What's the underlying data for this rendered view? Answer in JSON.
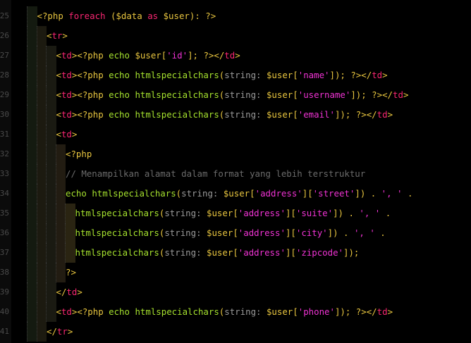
{
  "editor": {
    "theme": {
      "background": "#000000",
      "tag": "#f92672",
      "keyword": "#f92672",
      "function": "#a6e22e",
      "variable": "#e8c53f",
      "string": "#f033d4",
      "comment": "#6b6b6b",
      "param_hint": "#9a9a9a",
      "line_number": "#4a4a4a"
    },
    "lines": [
      {
        "num": "25",
        "depth": 3,
        "tokens": [
          [
            "t-php",
            "<?php "
          ],
          [
            "t-kw",
            "foreach"
          ],
          [
            "t-plain",
            " ("
          ],
          [
            "t-var",
            "$data"
          ],
          [
            "t-plain",
            " "
          ],
          [
            "t-kw",
            "as"
          ],
          [
            "t-plain",
            " "
          ],
          [
            "t-var",
            "$user"
          ],
          [
            "t-plain",
            "): ?>"
          ]
        ]
      },
      {
        "num": "26",
        "depth": 4,
        "tokens": [
          [
            "t-punc",
            "<"
          ],
          [
            "t-tag",
            "tr"
          ],
          [
            "t-punc",
            ">"
          ]
        ]
      },
      {
        "num": "27",
        "depth": 5,
        "tokens": [
          [
            "t-punc",
            "<"
          ],
          [
            "t-tag",
            "td"
          ],
          [
            "t-punc",
            ">"
          ],
          [
            "t-php",
            "<?php "
          ],
          [
            "t-fn",
            "echo"
          ],
          [
            "t-plain",
            " "
          ],
          [
            "t-var",
            "$user"
          ],
          [
            "t-punc",
            "["
          ],
          [
            "t-str",
            "'id'"
          ],
          [
            "t-punc",
            "]; ?></"
          ],
          [
            "t-tag",
            "td"
          ],
          [
            "t-punc",
            ">"
          ]
        ]
      },
      {
        "num": "28",
        "depth": 5,
        "tokens": [
          [
            "t-punc",
            "<"
          ],
          [
            "t-tag",
            "td"
          ],
          [
            "t-punc",
            ">"
          ],
          [
            "t-php",
            "<?php "
          ],
          [
            "t-fn",
            "echo"
          ],
          [
            "t-plain",
            " "
          ],
          [
            "t-fn",
            "htmlspecialchars"
          ],
          [
            "t-punc",
            "("
          ],
          [
            "t-param",
            "string: "
          ],
          [
            "t-var",
            "$user"
          ],
          [
            "t-punc",
            "["
          ],
          [
            "t-str",
            "'name'"
          ],
          [
            "t-punc",
            "]); ?></"
          ],
          [
            "t-tag",
            "td"
          ],
          [
            "t-punc",
            ">"
          ]
        ]
      },
      {
        "num": "29",
        "depth": 5,
        "tokens": [
          [
            "t-punc",
            "<"
          ],
          [
            "t-tag",
            "td"
          ],
          [
            "t-punc",
            ">"
          ],
          [
            "t-php",
            "<?php "
          ],
          [
            "t-fn",
            "echo"
          ],
          [
            "t-plain",
            " "
          ],
          [
            "t-fn",
            "htmlspecialchars"
          ],
          [
            "t-punc",
            "("
          ],
          [
            "t-param",
            "string: "
          ],
          [
            "t-var",
            "$user"
          ],
          [
            "t-punc",
            "["
          ],
          [
            "t-str",
            "'username'"
          ],
          [
            "t-punc",
            "]); ?></"
          ],
          [
            "t-tag",
            "td"
          ],
          [
            "t-punc",
            ">"
          ]
        ]
      },
      {
        "num": "30",
        "depth": 5,
        "tokens": [
          [
            "t-punc",
            "<"
          ],
          [
            "t-tag",
            "td"
          ],
          [
            "t-punc",
            ">"
          ],
          [
            "t-php",
            "<?php "
          ],
          [
            "t-fn",
            "echo"
          ],
          [
            "t-plain",
            " "
          ],
          [
            "t-fn",
            "htmlspecialchars"
          ],
          [
            "t-punc",
            "("
          ],
          [
            "t-param",
            "string: "
          ],
          [
            "t-var",
            "$user"
          ],
          [
            "t-punc",
            "["
          ],
          [
            "t-str",
            "'email'"
          ],
          [
            "t-punc",
            "]); ?></"
          ],
          [
            "t-tag",
            "td"
          ],
          [
            "t-punc",
            ">"
          ]
        ]
      },
      {
        "num": "31",
        "depth": 5,
        "tokens": [
          [
            "t-punc",
            "<"
          ],
          [
            "t-tag",
            "td"
          ],
          [
            "t-punc",
            ">"
          ]
        ]
      },
      {
        "num": "32",
        "depth": 6,
        "tokens": [
          [
            "t-php",
            "<?php"
          ]
        ]
      },
      {
        "num": "33",
        "depth": 6,
        "tokens": [
          [
            "t-cmt",
            "// Menampilkan alamat dalam format yang lebih terstruktur"
          ]
        ]
      },
      {
        "num": "34",
        "depth": 6,
        "tokens": [
          [
            "t-fn",
            "echo"
          ],
          [
            "t-plain",
            " "
          ],
          [
            "t-fn",
            "htmlspecialchars"
          ],
          [
            "t-punc",
            "("
          ],
          [
            "t-param",
            "string: "
          ],
          [
            "t-var",
            "$user"
          ],
          [
            "t-punc",
            "["
          ],
          [
            "t-str",
            "'address'"
          ],
          [
            "t-punc",
            "]["
          ],
          [
            "t-str",
            "'street'"
          ],
          [
            "t-punc",
            "]) . "
          ],
          [
            "t-str",
            "', '"
          ],
          [
            "t-punc",
            " ."
          ]
        ]
      },
      {
        "num": "35",
        "depth": 7,
        "tokens": [
          [
            "t-fn",
            "htmlspecialchars"
          ],
          [
            "t-punc",
            "("
          ],
          [
            "t-param",
            "string: "
          ],
          [
            "t-var",
            "$user"
          ],
          [
            "t-punc",
            "["
          ],
          [
            "t-str",
            "'address'"
          ],
          [
            "t-punc",
            "]["
          ],
          [
            "t-str",
            "'suite'"
          ],
          [
            "t-punc",
            "]) . "
          ],
          [
            "t-str",
            "', '"
          ],
          [
            "t-punc",
            " ."
          ]
        ]
      },
      {
        "num": "36",
        "depth": 7,
        "tokens": [
          [
            "t-fn",
            "htmlspecialchars"
          ],
          [
            "t-punc",
            "("
          ],
          [
            "t-param",
            "string: "
          ],
          [
            "t-var",
            "$user"
          ],
          [
            "t-punc",
            "["
          ],
          [
            "t-str",
            "'address'"
          ],
          [
            "t-punc",
            "]["
          ],
          [
            "t-str",
            "'city'"
          ],
          [
            "t-punc",
            "]) . "
          ],
          [
            "t-str",
            "', '"
          ],
          [
            "t-punc",
            " ."
          ]
        ]
      },
      {
        "num": "37",
        "depth": 7,
        "tokens": [
          [
            "t-fn",
            "htmlspecialchars"
          ],
          [
            "t-punc",
            "("
          ],
          [
            "t-param",
            "string: "
          ],
          [
            "t-var",
            "$user"
          ],
          [
            "t-punc",
            "["
          ],
          [
            "t-str",
            "'address'"
          ],
          [
            "t-punc",
            "]["
          ],
          [
            "t-str",
            "'zipcode'"
          ],
          [
            "t-punc",
            "]);"
          ]
        ]
      },
      {
        "num": "38",
        "depth": 6,
        "tokens": [
          [
            "t-php",
            "?>"
          ]
        ]
      },
      {
        "num": "39",
        "depth": 5,
        "tokens": [
          [
            "t-punc",
            "</"
          ],
          [
            "t-tag",
            "td"
          ],
          [
            "t-punc",
            ">"
          ]
        ]
      },
      {
        "num": "40",
        "depth": 5,
        "tokens": [
          [
            "t-punc",
            "<"
          ],
          [
            "t-tag",
            "td"
          ],
          [
            "t-punc",
            ">"
          ],
          [
            "t-php",
            "<?php "
          ],
          [
            "t-fn",
            "echo"
          ],
          [
            "t-plain",
            " "
          ],
          [
            "t-fn",
            "htmlspecialchars"
          ],
          [
            "t-punc",
            "("
          ],
          [
            "t-param",
            "string: "
          ],
          [
            "t-var",
            "$user"
          ],
          [
            "t-punc",
            "["
          ],
          [
            "t-str",
            "'phone'"
          ],
          [
            "t-punc",
            "]); ?></"
          ],
          [
            "t-tag",
            "td"
          ],
          [
            "t-punc",
            ">"
          ]
        ]
      },
      {
        "num": "41",
        "depth": 4,
        "tokens": [
          [
            "t-punc",
            "</"
          ],
          [
            "t-tag",
            "tr"
          ],
          [
            "t-punc",
            ">"
          ]
        ]
      }
    ]
  }
}
